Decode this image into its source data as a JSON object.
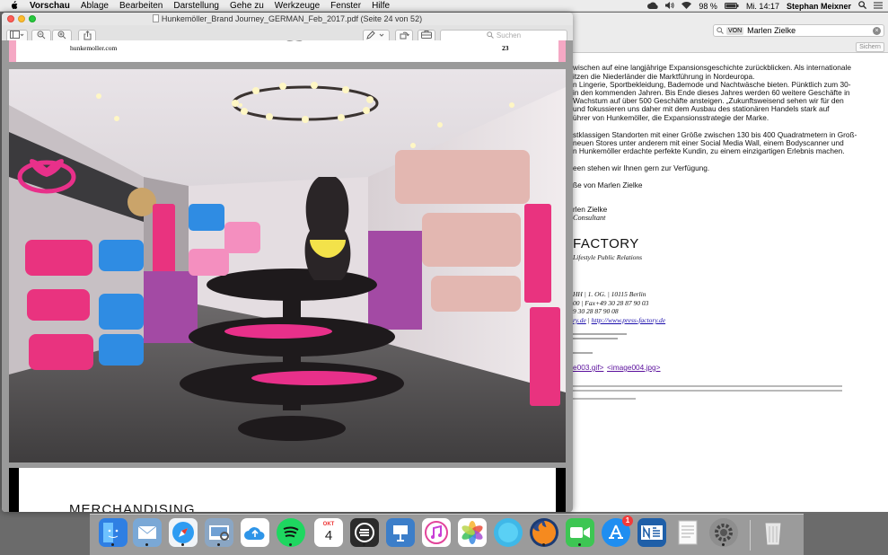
{
  "menubar": {
    "app": "Vorschau",
    "items": [
      "Ablage",
      "Bearbeiten",
      "Darstellung",
      "Gehe zu",
      "Werkzeuge",
      "Fenster",
      "Hilfe"
    ],
    "battery": "98 %",
    "clock": "Mi. 14:17",
    "user": "Stephan Meixner"
  },
  "preview": {
    "title": "Hunkemöller_Brand Journey_GERMAN_Feb_2017.pdf (Seite 24 von 52)",
    "search_placeholder": "Suchen",
    "page_site": "hunkemoller.com",
    "page_number": "23",
    "next_heading": "MERCHANDISING"
  },
  "mail": {
    "search_token": "VON",
    "search_value": "Marlen Zielke",
    "save_label": "Sichern",
    "lines": [
      "wischen auf eine langjährige Expansionsgeschichte zurückblicken. Als internationale",
      "itzen die Niederländer die Marktführung in Nordeuropa.",
      "n Lingerie, Sportbekleidung, Bademode und Nachtwäsche bieten. Pünktlich zum 30-",
      "in den kommenden Jahren. Bis Ende dieses Jahres werden 60 weitere Geschäfte in",
      "Wachstum auf über 500 Geschäfte ansteigen. „Zukunftsweisend sehen wir für den",
      "und fokussieren uns daher mit dem Ausbau des stationären Handels stark auf",
      "ührer von Hunkemöller, die Expansionsstrategie der Marke.",
      "stklassigen Standorten mit einer Größe zwischen 130 bis 400 Quadratmetern in Groß-",
      "neuen Stores unter anderem mit einer Social Media Wall, einem Bodyscanner und",
      "n Hunkemöller erdachte perfekte Kundin, zu einem einzigartigen Erlebnis machen.",
      "een stehen wir Ihnen gern zur Verfügung.",
      "ße von Marlen Zielke",
      "rlen Zielke",
      "Consultant",
      "FACTORY",
      "Lifestyle Public Relations",
      "HH  | 1. OG. | 10115 Berlin",
      "00 | Fax+49 30 28 87 90 03",
      "9 30 28 87 90 08",
      "ry.de",
      "http://www.press-factory.de",
      "e003.gif>",
      "<image004.jpg>"
    ]
  },
  "dock": {
    "calendar_month": "OKT",
    "calendar_day": "4",
    "appstore_badge": "1"
  }
}
